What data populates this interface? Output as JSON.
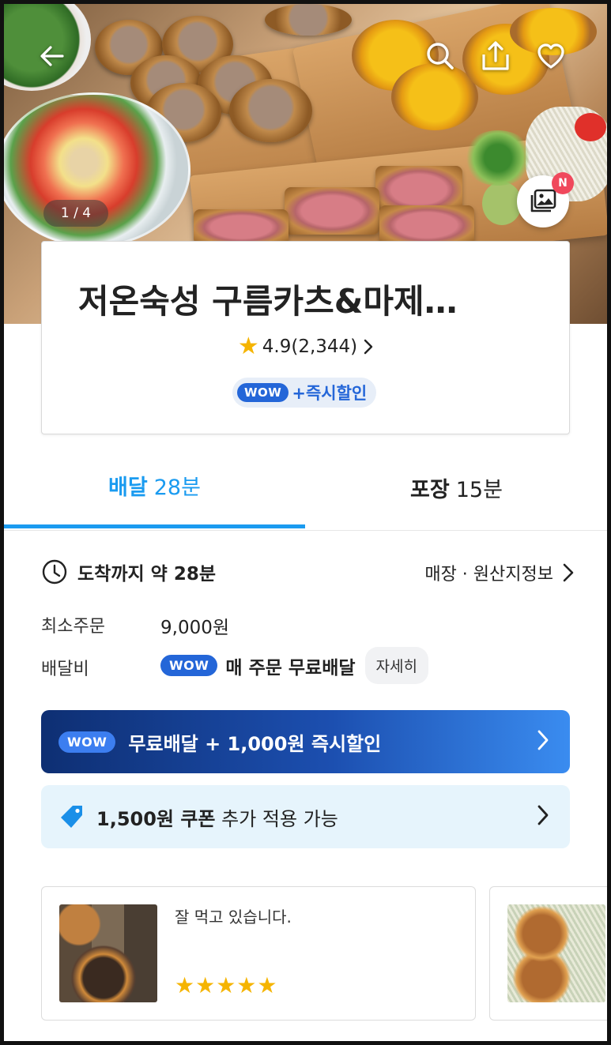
{
  "header": {
    "photo_counter": "1 / 4",
    "new_badge": "N",
    "icons": [
      "back-arrow-icon",
      "search-icon",
      "share-icon",
      "heart-icon",
      "photo-gallery-icon"
    ]
  },
  "store": {
    "name": "저온숙성 구름카츠&마제…",
    "rating": "4.9",
    "review_count": "(2,344)",
    "wow_label": "WOW",
    "wow_promo": "+즉시할인"
  },
  "tabs": [
    {
      "label": "배달",
      "time": "28분",
      "active": true
    },
    {
      "label": "포장",
      "time": "15분",
      "active": false
    }
  ],
  "info": {
    "arrival": "도착까지 약 28분",
    "origin_link": "매장 · 원산지정보",
    "min_order_label": "최소주문",
    "min_order_value": "9,000원",
    "delivery_fee_label": "배달비",
    "wow_label": "WOW",
    "delivery_fee_value": "매 주문 무료배달",
    "detail_button": "자세히"
  },
  "banners": {
    "wow_label": "WOW",
    "wow_text": "무료배달 + 1,000원 즉시할인",
    "coupon_amount": "1,500원 쿠폰",
    "coupon_text": " 추가 적용 가능"
  },
  "reviews": [
    {
      "text": "잘 먹고 있습니다.",
      "stars": "★★★★★",
      "rating": 5
    }
  ],
  "colors": {
    "accent": "#1a9bf0",
    "wow_blue": "#2466d8",
    "star": "#f5b400",
    "badge_red": "#f0485c"
  }
}
